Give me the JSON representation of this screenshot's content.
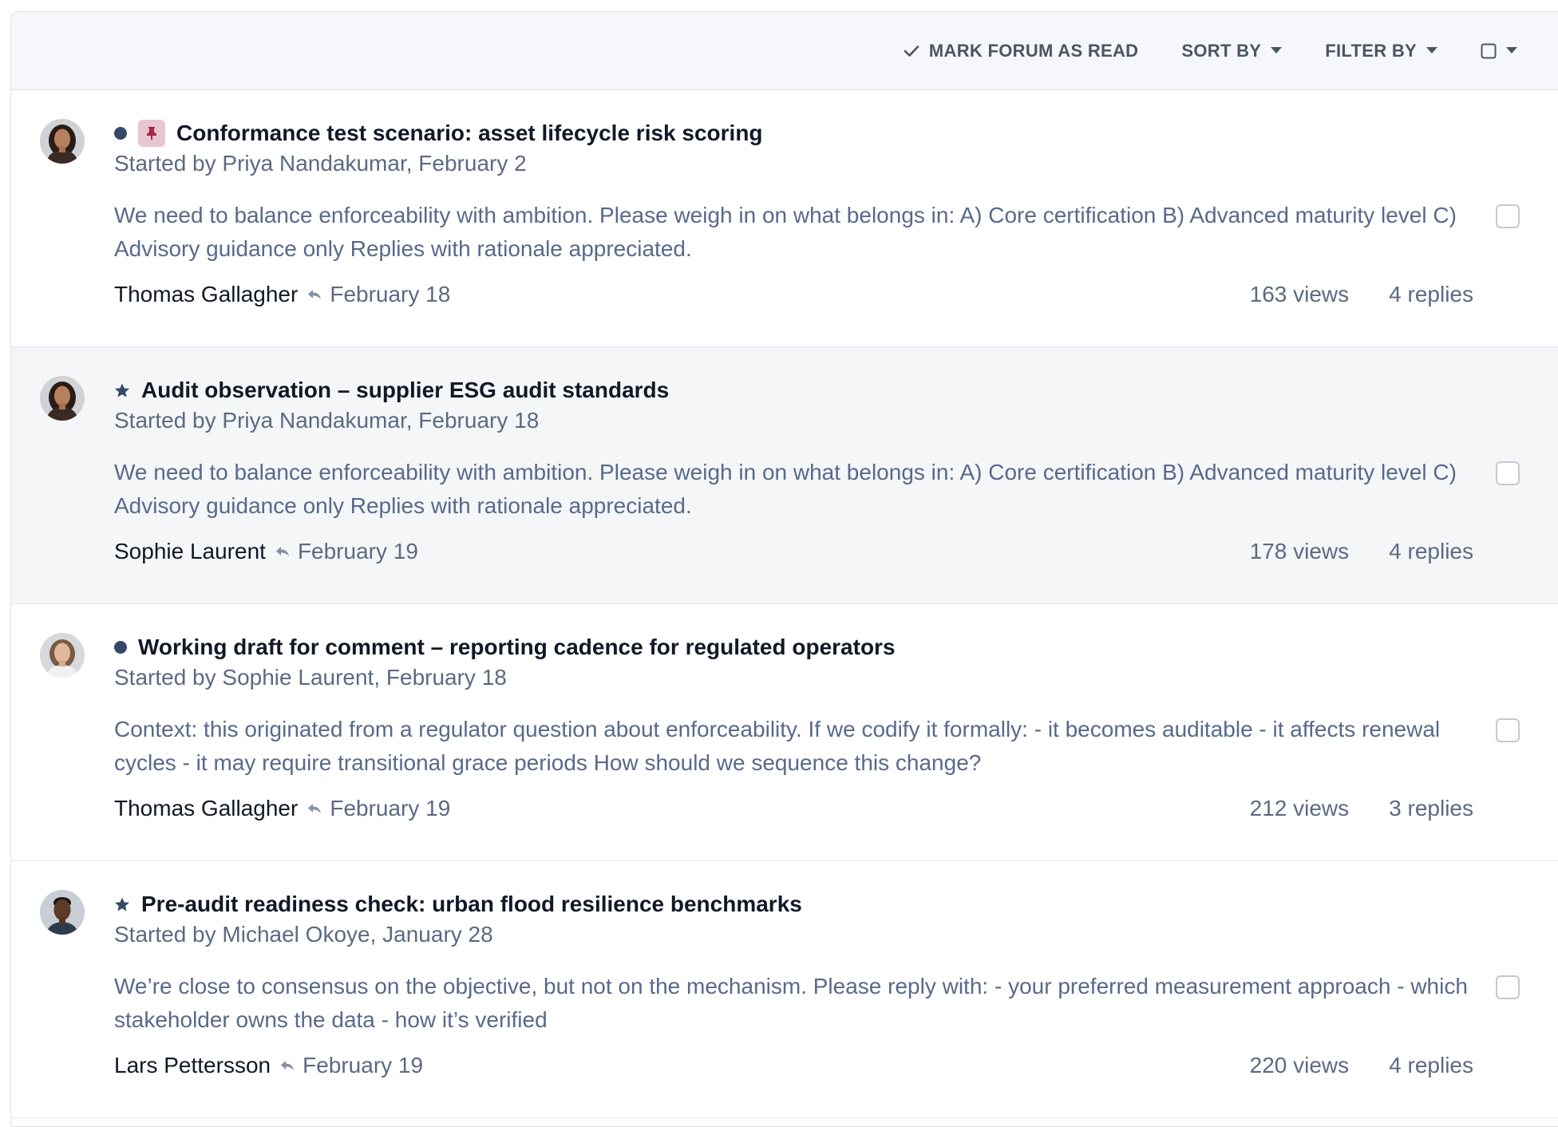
{
  "toolbar": {
    "mark_read_label": "MARK FORUM AS READ",
    "sort_label": "SORT BY",
    "filter_label": "FILTER BY"
  },
  "threads": [
    {
      "title": "Conformance test scenario: asset lifecycle risk scoring",
      "started": "Started by Priya Nandakumar, February 2",
      "excerpt": "We need to balance enforceability with ambition. Please weigh in on what belongs in: A) Core certification B) Advanced maturity level C) Advisory guidance only Replies with rationale appreciated.",
      "last_author": "Thomas Gallagher",
      "last_date": "February 18",
      "views": "163 views",
      "replies": "4 replies"
    },
    {
      "title": "Audit observation – supplier ESG audit standards",
      "started": "Started by Priya Nandakumar, February 18",
      "excerpt": "We need to balance enforceability with ambition. Please weigh in on what belongs in: A) Core certification B) Advanced maturity level C) Advisory guidance only Replies with rationale appreciated.",
      "last_author": "Sophie Laurent",
      "last_date": "February 19",
      "views": "178 views",
      "replies": "4 replies"
    },
    {
      "title": "Working draft for comment – reporting cadence for regulated operators",
      "started": "Started by Sophie Laurent, February 18",
      "excerpt": "Context: this originated from a regulator question about enforceability. If we codify it formally: - it becomes auditable - it affects renewal cycles - it may require transitional grace periods How should we sequence this change?",
      "last_author": "Thomas Gallagher",
      "last_date": "February 19",
      "views": "212 views",
      "replies": "3 replies"
    },
    {
      "title": "Pre-audit readiness check: urban flood resilience benchmarks",
      "started": "Started by Michael Okoye, January 28",
      "excerpt": "We’re close to consensus on the objective, but not on the mechanism. Please reply with: - your preferred measurement approach - which stakeholder owns the data - how it’s verified",
      "last_author": "Lars Pettersson",
      "last_date": "February 19",
      "views": "220 views",
      "replies": "4 replies"
    }
  ]
}
